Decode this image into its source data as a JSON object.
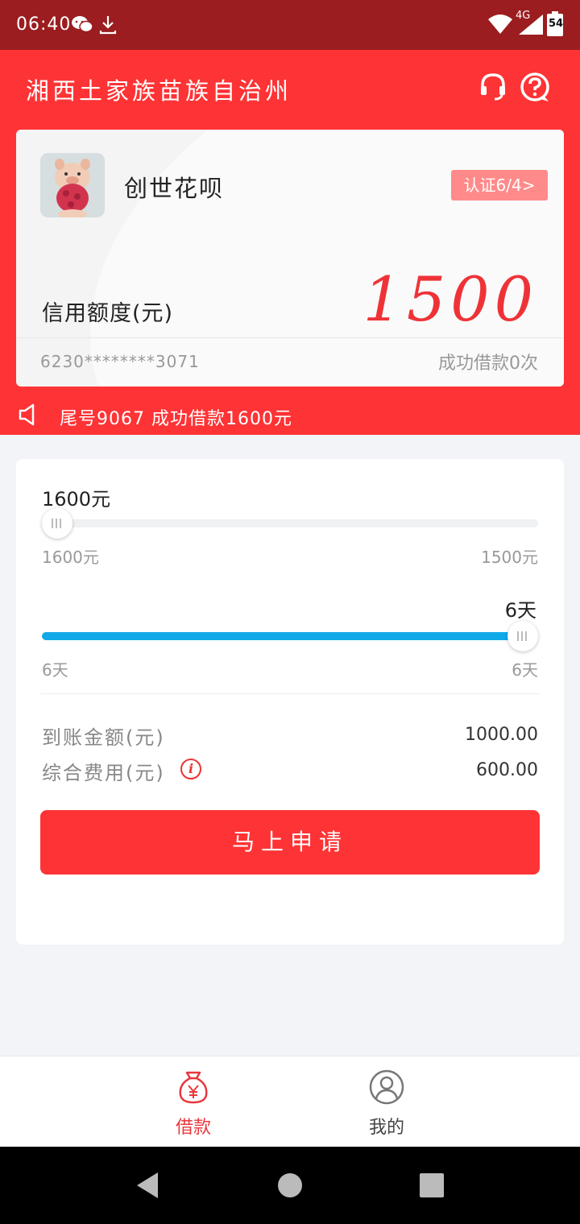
{
  "status_bar": {
    "time": "06:40",
    "network": "4G",
    "battery": "54"
  },
  "header": {
    "title": "湘西土家族苗族自治州",
    "icons": [
      "headset-icon",
      "help-icon"
    ]
  },
  "card": {
    "product_name": "创世花呗",
    "cert_badge": "认证6/4>",
    "credit_label": "信用额度(元)",
    "credit_amount": "1500",
    "card_number": "6230********3071",
    "success_count": "成功借款0次"
  },
  "notice": {
    "text": "尾号9067 成功借款1600元"
  },
  "loan": {
    "amount_selected": "1600元",
    "amount_min": "1600元",
    "amount_max": "1500元",
    "amount_level": 0.0,
    "term_selected": "6天",
    "term_min": "6天",
    "term_max": "6天",
    "term_level": 1.0,
    "received_label": "到账金额(元)",
    "received_value": "1000.00",
    "fee_label": "综合费用(元)",
    "fee_value": "600.00",
    "apply_label": "马上申请"
  },
  "tabbar": {
    "tabs": [
      {
        "label": "借款",
        "icon": "money-bag-icon",
        "active": true
      },
      {
        "label": "我的",
        "icon": "profile-icon",
        "active": false
      }
    ]
  },
  "colors": {
    "brand_red": "#fe3335",
    "status_bar": "#9b1d1f",
    "slider_blue": "#12a9e8"
  }
}
